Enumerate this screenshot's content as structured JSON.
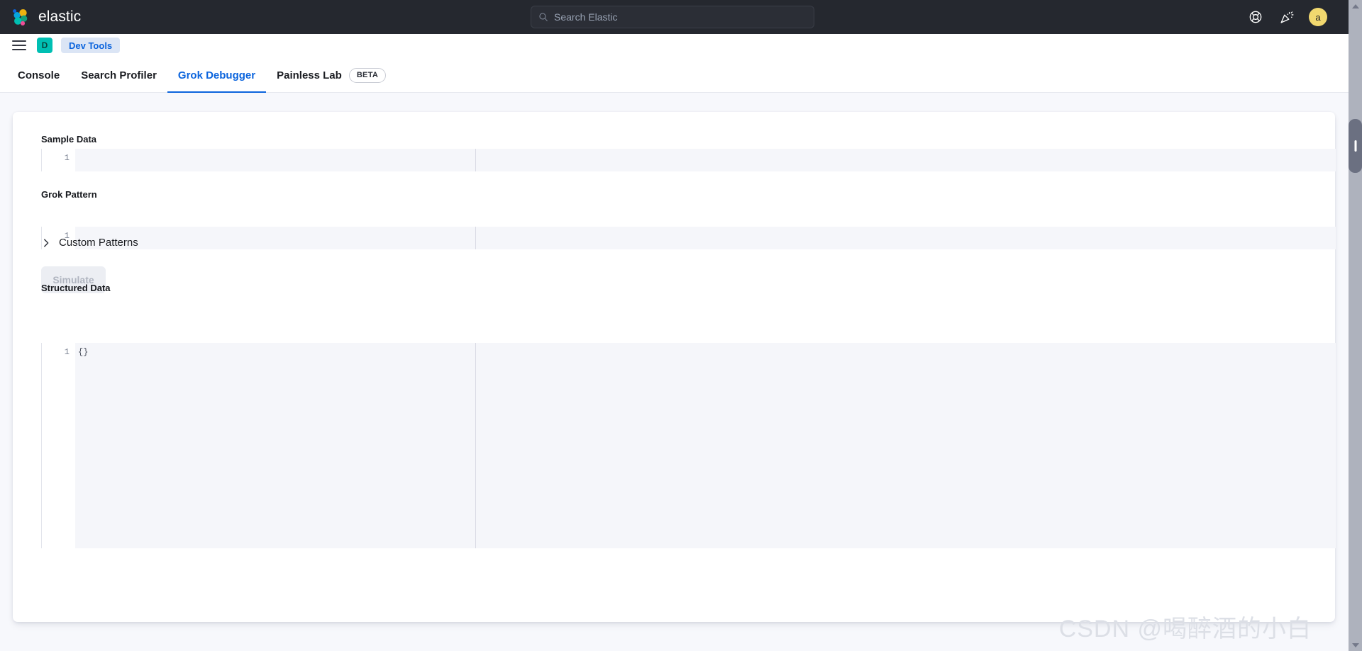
{
  "header": {
    "brand_name": "elastic",
    "logo_icon": "elastic-logo-icon",
    "search": {
      "placeholder": "Search Elastic",
      "value": "",
      "icon": "search-icon"
    },
    "help_icon": "lifebuoy-help-icon",
    "announcements_icon": "party-popper-announcements-icon",
    "avatar_initial": "a",
    "avatar_color": "#f1d86f"
  },
  "breadcrumb": {
    "menu_icon": "hamburger-menu-icon",
    "app_badge": "D",
    "app_badge_color": "#00bfb3",
    "crumb": "Dev Tools",
    "crumb_color": "#0b64dd"
  },
  "tabs": [
    {
      "label": "Console",
      "active": false
    },
    {
      "label": "Search Profiler",
      "active": false
    },
    {
      "label": "Grok Debugger",
      "active": true
    },
    {
      "label": "Painless Lab",
      "active": false
    }
  ],
  "beta_badge": "BETA",
  "accent_color": "#0b64dd",
  "form": {
    "sample_data": {
      "label": "Sample Data",
      "line_number": "1",
      "value": ""
    },
    "grok_pattern": {
      "label": "Grok Pattern",
      "line_number": "1",
      "value": ""
    },
    "custom_patterns": {
      "label": "Custom Patterns",
      "expanded": false,
      "icon": "chevron-right-icon"
    },
    "simulate_button": {
      "label": "Simulate",
      "disabled": true
    },
    "structured_data": {
      "label": "Structured Data",
      "line_number": "1",
      "value": "{}"
    }
  },
  "watermark": "CSDN @喝醉酒的小白",
  "scrollbar": {
    "up_icon": "scroll-up-arrow-icon",
    "down_icon": "scroll-down-arrow-icon"
  }
}
